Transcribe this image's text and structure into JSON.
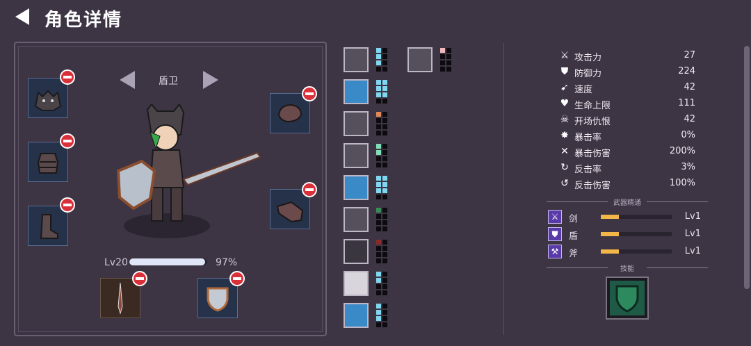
{
  "header": {
    "title": "角色详情"
  },
  "character": {
    "class_name": "盾卫",
    "level_label": "Lv20",
    "xp_fraction": 0.97,
    "xp_percent": "97%"
  },
  "stats": [
    {
      "icon": "sword-icon",
      "name": "攻击力",
      "value": "27"
    },
    {
      "icon": "shield-icon",
      "name": "防御力",
      "value": "224"
    },
    {
      "icon": "boot-icon",
      "name": "速度",
      "value": "42"
    },
    {
      "icon": "heart-icon",
      "name": "生命上限",
      "value": "111"
    },
    {
      "icon": "skull-icon",
      "name": "开场仇恨",
      "value": "42"
    },
    {
      "icon": "crit-icon",
      "name": "暴击率",
      "value": "0%"
    },
    {
      "icon": "crit-damage-icon",
      "name": "暴击伤害",
      "value": "200%"
    },
    {
      "icon": "counter-icon",
      "name": "反击率",
      "value": "3%"
    },
    {
      "icon": "counter-damage-icon",
      "name": "反击伤害",
      "value": "100%"
    }
  ],
  "weapon_mastery": {
    "title": "武器精通",
    "items": [
      {
        "name": "剑",
        "level": "Lv1",
        "fraction": 0.25
      },
      {
        "name": "盾",
        "level": "Lv1",
        "fraction": 0.25
      },
      {
        "name": "斧",
        "level": "Lv1",
        "fraction": 0.25
      }
    ]
  },
  "skills_section": {
    "title": "技能"
  },
  "colors": {
    "background": "#3d3444",
    "remove_badge": "#d9303a",
    "mastery_bar": "#f3b648"
  }
}
